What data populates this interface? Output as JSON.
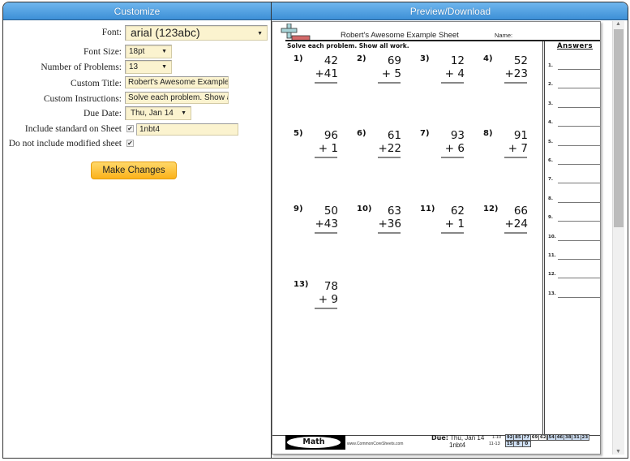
{
  "panels": {
    "customize_title": "Customize",
    "preview_title": "Preview/Download"
  },
  "form": {
    "font": {
      "label": "Font:",
      "value": "arial (123abc)"
    },
    "font_size": {
      "label": "Font Size:",
      "value": "18pt"
    },
    "num_problems": {
      "label": "Number of Problems:",
      "value": "13"
    },
    "custom_title": {
      "label": "Custom Title:",
      "value": "Robert's Awesome Example"
    },
    "custom_instructions": {
      "label": "Custom Instructions:",
      "value": "Solve each problem. Show a"
    },
    "due_date": {
      "label": "Due Date:",
      "value": "Thu, Jan 14"
    },
    "include_standard": {
      "label": "Include standard on Sheet",
      "checked": true,
      "value": "1nbt4"
    },
    "no_modified": {
      "label": "Do not include modified sheet",
      "checked": true
    },
    "submit_label": "Make Changes"
  },
  "sheet": {
    "title": "Robert's Awesome Example Sheet",
    "name_label": "Name:",
    "instructions": "Solve each problem. Show all work.",
    "answers_title": "Answers",
    "problems": [
      {
        "num": "1)",
        "a": "42",
        "b": "+41"
      },
      {
        "num": "2)",
        "a": "69",
        "b": "+ 5"
      },
      {
        "num": "3)",
        "a": "12",
        "b": "+ 4"
      },
      {
        "num": "4)",
        "a": "52",
        "b": "+23"
      },
      {
        "num": "5)",
        "a": "96",
        "b": "+ 1"
      },
      {
        "num": "6)",
        "a": "61",
        "b": "+22"
      },
      {
        "num": "7)",
        "a": "93",
        "b": "+ 6"
      },
      {
        "num": "8)",
        "a": "91",
        "b": "+ 7"
      },
      {
        "num": "9)",
        "a": "50",
        "b": "+43"
      },
      {
        "num": "10)",
        "a": "63",
        "b": "+36"
      },
      {
        "num": "11)",
        "a": "62",
        "b": "+ 1"
      },
      {
        "num": "12)",
        "a": "66",
        "b": "+24"
      },
      {
        "num": "13)",
        "a": "78",
        "b": "+ 9"
      }
    ],
    "answer_numbers": [
      "1.",
      "2.",
      "3.",
      "4.",
      "5.",
      "6.",
      "7.",
      "8.",
      "9.",
      "10.",
      "11.",
      "12.",
      "13."
    ],
    "footer": {
      "subject": "Math",
      "site": "www.CommonCoreSheets.com",
      "due_label": "Due:",
      "due_value": "Thu, Jan 14",
      "standard": "1nbt4",
      "score_row1_label": "1-10",
      "score_row1": [
        "92",
        "85",
        "77",
        "69",
        "62",
        "54",
        "46",
        "38",
        "31",
        "23"
      ],
      "score_row2_label": "11-13",
      "score_row2": [
        "15",
        "8",
        "0"
      ]
    }
  },
  "colors": {
    "header_blue": "#3d8fd6",
    "input_bg": "#fbf3cf",
    "button_orange": "#fbb21a",
    "score_blue": "#cfe0f5"
  }
}
